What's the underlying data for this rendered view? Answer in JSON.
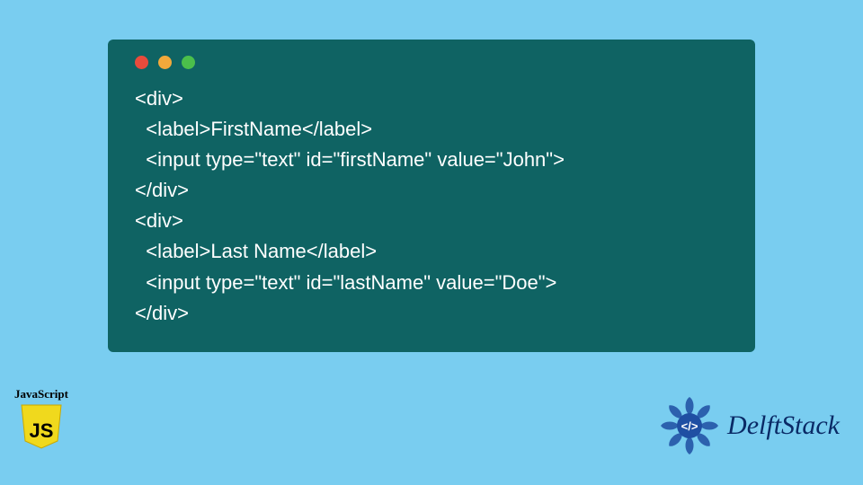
{
  "code": {
    "lines": [
      "<div>",
      "  <label>FirstName</label>",
      "  <input type=\"text\" id=\"firstName\" value=\"John\">",
      "</div>",
      "<div>",
      "  <label>Last Name</label>",
      "  <input type=\"text\" id=\"lastName\" value=\"Doe\">",
      "</div>"
    ]
  },
  "badges": {
    "js_label": "JavaScript",
    "js_letters": "JS",
    "delft_text": "DelftStack"
  },
  "colors": {
    "background": "#79cdf0",
    "window": "#0f6363",
    "js_yellow": "#f0d91d",
    "delft_blue": "#1f4fa3"
  }
}
